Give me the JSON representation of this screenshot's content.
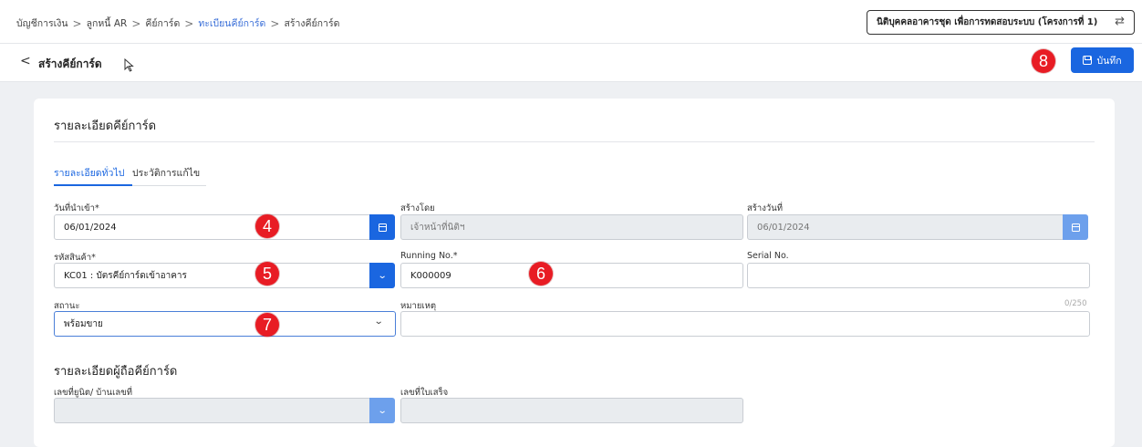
{
  "breadcrumb": {
    "items": [
      "บัญชีการเงิน",
      "ลูกหนี้ AR",
      "คีย์การ์ด",
      "ทะเบียนคีย์การ์ด",
      "สร้างคีย์การ์ด"
    ],
    "separator": ">"
  },
  "project_selector": {
    "label": "นิติบุคคลอาคารชุด เพื่อการทดสอบระบบ (โครงการที่ 1)",
    "icon": "swap-icon"
  },
  "header": {
    "back_icon": "<",
    "title": "สร้างคีย์การ์ด",
    "save_label": "บันทึก"
  },
  "card": {
    "title": "รายละเอียดคีย์การ์ด",
    "tabs": [
      {
        "label": "รายละเอียดทั่วไป",
        "active": true
      },
      {
        "label": "ประวัติการแก้ไข",
        "active": false
      }
    ]
  },
  "form": {
    "import_date": {
      "label": "วันที่นำเข้า*",
      "value": "06/01/2024"
    },
    "created_by": {
      "label": "สร้างโดย",
      "value": "เจ้าหน้าที่นิติฯ"
    },
    "created_date": {
      "label": "สร้างวันที่",
      "value": "06/01/2024"
    },
    "product_code": {
      "label": "รหัสสินค้า*",
      "value": "KC01 : บัตรคีย์การ์ดเข้าอาคาร"
    },
    "running_no": {
      "label": "Running No.*",
      "value": "K000009"
    },
    "serial_no": {
      "label": "Serial No.",
      "value": ""
    },
    "status": {
      "label": "สถานะ",
      "value": "พร้อมขาย"
    },
    "remark": {
      "label": "หมายเหตุ",
      "value": "",
      "counter": "0/250"
    }
  },
  "holder": {
    "title": "รายละเอียดผู้ถือคีย์การ์ด",
    "unit": {
      "label": "เลขที่ยูนิต/ บ้านเลขที่",
      "value": ""
    },
    "receipt": {
      "label": "เลขที่ใบเสร็จ",
      "value": ""
    }
  },
  "annotations": {
    "b4": "4",
    "b5": "5",
    "b6": "6",
    "b7": "7",
    "b8": "8"
  },
  "colors": {
    "primary": "#1a66e0",
    "link": "#3a6fd8",
    "badge": "#e81c24",
    "background": "#eef0f3"
  }
}
